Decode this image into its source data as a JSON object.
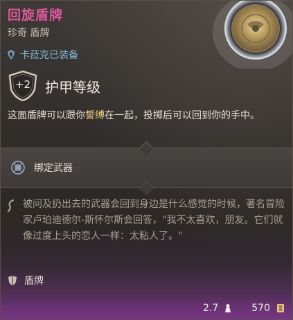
{
  "item": {
    "name": "回旋盾牌",
    "type": "珍奇 盾牌",
    "equipped_text": "卡菈克已装备",
    "armor_bonus": "+2",
    "armor_label": "护甲等级",
    "description_before": "这面盾牌可以跟你",
    "description_keyword": "誓缚",
    "description_after": "在一起，投掷后可以回到你的手中。",
    "bound_weapon_label": "绑定武器",
    "lore": "被问及扔出去的武器会回到身边是什么感觉的时候，著名冒险家卢珀迪德尔-斯怀尔斯会回答，\"我不太喜欢，朋友。它们就像过度上头的恋人一样：太粘人了。\"",
    "category": "盾牌",
    "weight": "2.7",
    "value": "570"
  },
  "colors": {
    "rarity": "#e0589c",
    "equipped": "#7fb8d8",
    "keyword": "#f0d07a"
  },
  "icons": {
    "equipped": "armor-figure-icon",
    "armor": "shield-outline-icon",
    "bound": "bound-weapon-icon",
    "lore": "lore-curl-icon",
    "category": "shield-small-icon",
    "weight": "weight-icon",
    "gold": "gold-coin-icon"
  }
}
